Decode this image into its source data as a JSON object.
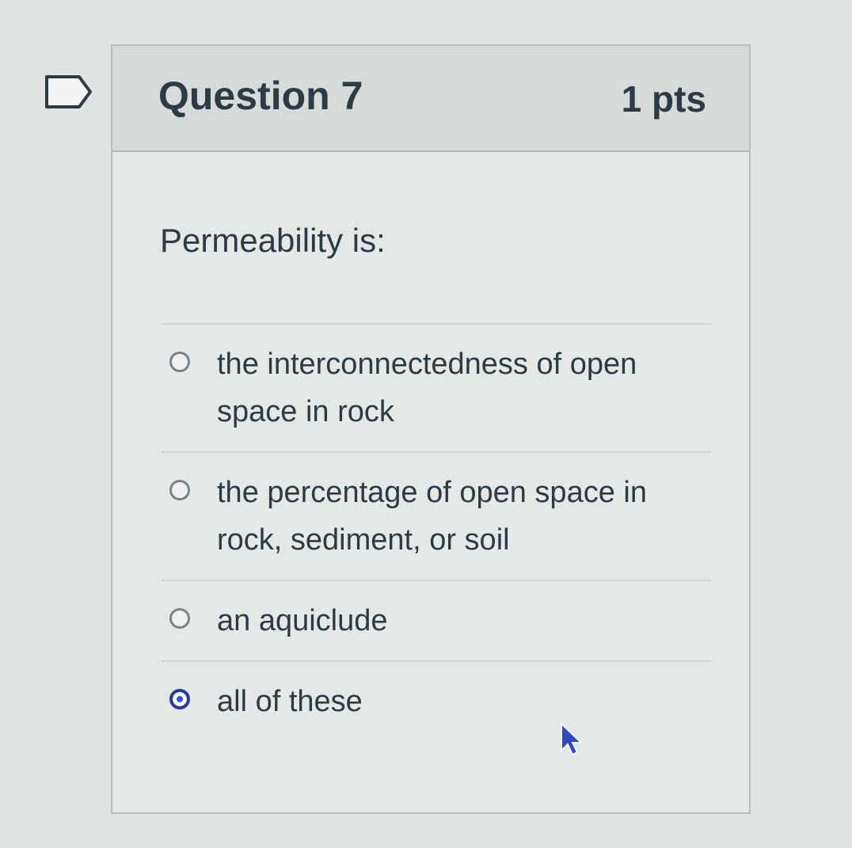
{
  "question": {
    "title": "Question 7",
    "points": "1 pts",
    "prompt": "Permeability is:"
  },
  "answers": [
    {
      "text_line1": "the interconnectedness of open",
      "text_line2": "space in rock",
      "selected": false
    },
    {
      "text_line1": "the percentage of open space in",
      "text_line2": "rock, sediment, or soil",
      "selected": false
    },
    {
      "text_line1": "an aquiclude",
      "text_line2": "",
      "selected": false
    },
    {
      "text_line1": "all of these",
      "text_line2": "",
      "selected": true
    }
  ],
  "icons": {
    "flag": "flag-icon",
    "cursor": "mouse-cursor-icon"
  },
  "colors": {
    "selected_radio": "#2f56d8",
    "text": "#2d3b45"
  }
}
